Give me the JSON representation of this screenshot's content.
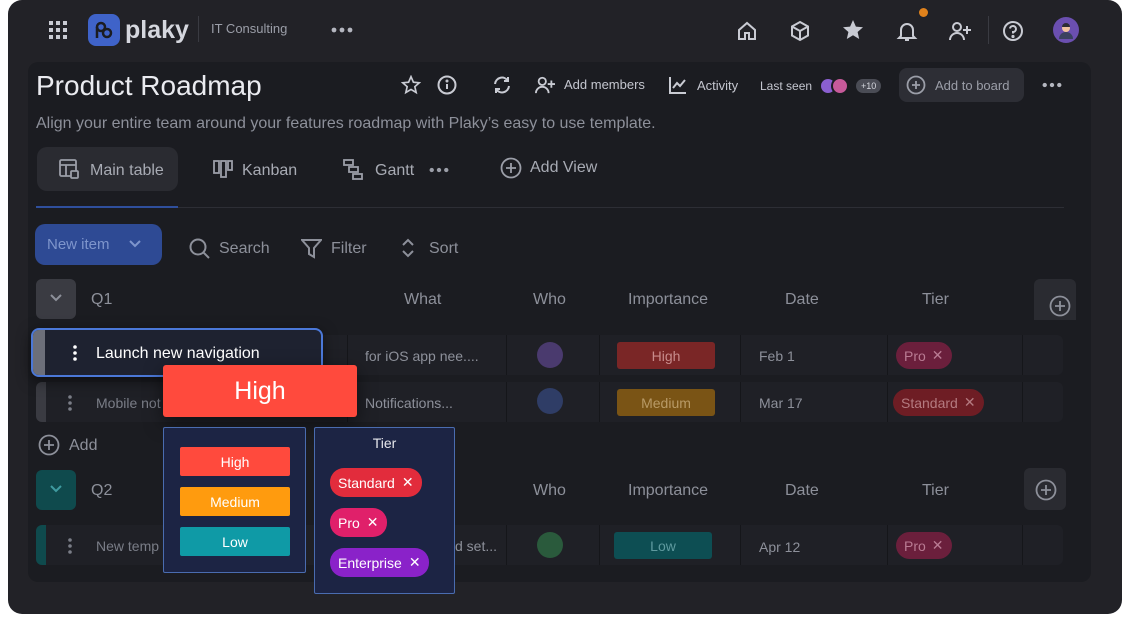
{
  "app": {
    "logo_text": "plaky",
    "workspace": "IT Consulting"
  },
  "colors": {
    "accent": "#3f63c9",
    "high": "#ff4a3d",
    "medium": "#ff9b0e",
    "low": "#0f9aa6",
    "pro": "#e0206a",
    "standard": "#e22c3c",
    "enterprise": "#8a22c9"
  },
  "topnav": {
    "icons": [
      "grid-icon",
      "home-icon",
      "box-icon",
      "star-icon",
      "bell-icon",
      "add-user-icon",
      "help-icon",
      "avatar"
    ]
  },
  "board": {
    "title": "Product Roadmap",
    "description": "Align your entire team around your features roadmap with Plaky’s easy to use template.",
    "add_members": "Add members",
    "activity": "Activity",
    "last_seen": "Last seen",
    "last_seen_count": "+10",
    "add_to_board": "Add to board"
  },
  "views": {
    "main_table": "Main table",
    "kanban": "Kanban",
    "gantt": "Gantt",
    "add_view": "Add View"
  },
  "toolbar": {
    "new_item": "New item",
    "search": "Search",
    "filter": "Filter",
    "sort": "Sort"
  },
  "columns": {
    "what": "What",
    "who": "Who",
    "importance": "Importance",
    "date": "Date",
    "tier": "Tier"
  },
  "groups": [
    {
      "name": "Q1",
      "rows": [
        {
          "name": "Launch new navigation",
          "what": "for iOS app nee....",
          "importance": "High",
          "date": "Feb 1",
          "tier": "Pro"
        },
        {
          "name": "Mobile not",
          "what": "Notifications...",
          "importance": "Medium",
          "date": "Mar 17",
          "tier": "Standard"
        }
      ],
      "add_label": "Add"
    },
    {
      "name": "Q2",
      "rows": [
        {
          "name": "New temp",
          "what": "d set...",
          "importance": "Low",
          "date": "Apr 12",
          "tier": "Pro"
        }
      ]
    }
  ],
  "drag_badge": "High",
  "importance_popup": {
    "options": [
      "High",
      "Medium",
      "Low"
    ]
  },
  "tier_popup": {
    "title": "Tier",
    "options": [
      "Standard",
      "Pro",
      "Enterprise"
    ]
  }
}
